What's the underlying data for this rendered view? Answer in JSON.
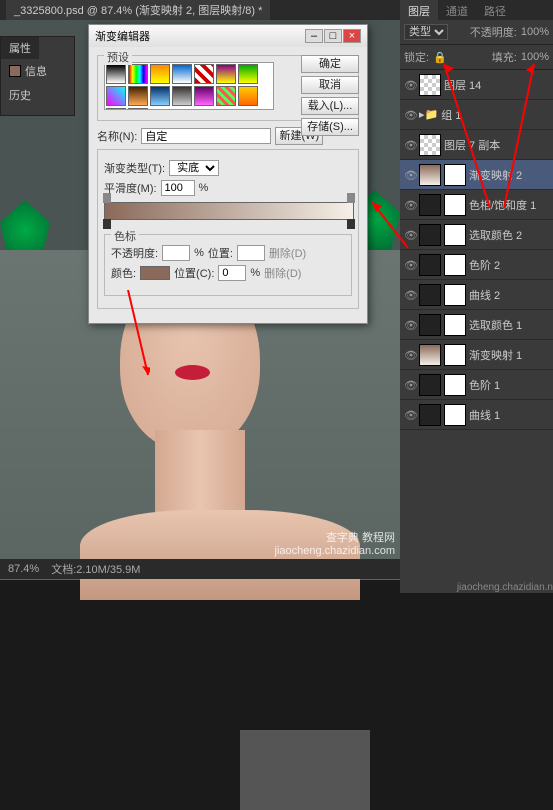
{
  "titlebar": {
    "doc": "_3325800.psd @ 87.4% (渐变映射 2, 图层映射/8) *"
  },
  "leftpanel": {
    "tab": "属性",
    "r1": "信息",
    "r2": "历史"
  },
  "dialog": {
    "title": "渐变编辑器",
    "presets_label": "预设",
    "buttons": {
      "ok": "确定",
      "cancel": "取消",
      "load": "载入(L)...",
      "save": "存储(S)..."
    },
    "name_label": "名称(N):",
    "name_value": "自定",
    "new_btn": "新建(W)",
    "type_label": "渐变类型(T):",
    "type_value": "实底",
    "smooth_label": "平滑度(M):",
    "smooth_value": "100",
    "smooth_unit": "%",
    "stops_label": "色标",
    "opacity_label": "不透明度:",
    "opacity_unit": "%",
    "pos1_label": "位置:",
    "del1": "删除(D)",
    "color_label": "颜色:",
    "pos2_label": "位置(C):",
    "pos2_value": "0",
    "pos2_unit": "%",
    "del2": "删除(D)"
  },
  "rightpanel": {
    "tabs": [
      "图层",
      "通道",
      "路径"
    ],
    "mode_label": "类型",
    "opacity_label": "不透明度:",
    "opacity_value": "100%",
    "lock_label": "锁定:",
    "fill_label": "填充:",
    "fill_value": "100%",
    "layers": [
      {
        "name": "图层 14",
        "type": "normal"
      },
      {
        "name": "组 1",
        "type": "group"
      },
      {
        "name": "图层 7 副本",
        "type": "normal"
      },
      {
        "name": "渐变映射 2",
        "type": "adj",
        "active": true
      },
      {
        "name": "色相/饱和度 1",
        "type": "adj"
      },
      {
        "name": "选取颜色 2",
        "type": "adj"
      },
      {
        "name": "色阶 2",
        "type": "adj"
      },
      {
        "name": "曲线 2",
        "type": "adj"
      },
      {
        "name": "选取颜色 1",
        "type": "adj"
      },
      {
        "name": "渐变映射 1",
        "type": "adj"
      },
      {
        "name": "色阶 1",
        "type": "adj"
      },
      {
        "name": "曲线 1",
        "type": "adj"
      }
    ]
  },
  "status": {
    "zoom": "87.4%",
    "info": "文档:2.10M/35.9M"
  },
  "watermark": {
    "l1": "查字典 教程网",
    "l2": "jiaocheng.chazidian.com"
  },
  "footer": "jiaocheng.chazidian.n"
}
